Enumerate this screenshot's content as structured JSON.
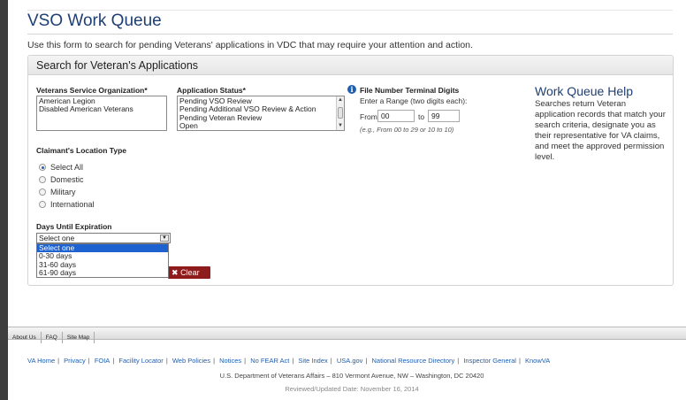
{
  "page": {
    "title": "VSO Work Queue",
    "intro": "Use this form to search for pending Veterans' applications in VDC that may require your attention and action."
  },
  "search_panel": {
    "heading": "Search for Veteran's Applications",
    "vso": {
      "label": "Veterans Service Organization*",
      "options": [
        "American Legion",
        "Disabled American Veterans"
      ]
    },
    "status": {
      "label": "Application Status*",
      "options": [
        "Pending VSO Review",
        "Pending Additional VSO Review & Action",
        "Pending Veteran Review",
        "Open"
      ]
    },
    "terminal_digits": {
      "label": "File Number Terminal Digits",
      "instruction": "Enter a Range (two digits each):",
      "from_label": "From",
      "from_value": "00",
      "to_label": "to",
      "to_value": "99",
      "hint": "(e.g., From 00 to 29 or 10 to 10)"
    },
    "location": {
      "label": "Claimant's Location Type",
      "options": [
        {
          "label": "Select All",
          "selected": true
        },
        {
          "label": "Domestic",
          "selected": false
        },
        {
          "label": "Military",
          "selected": false
        },
        {
          "label": "International",
          "selected": false
        }
      ]
    },
    "expiration": {
      "label": "Days Until Expiration",
      "selected": "Select one",
      "options": [
        "Select one",
        "0-30 days",
        "31-60 days",
        "61-90 days"
      ]
    },
    "clear_label": "Clear"
  },
  "help": {
    "title": "Work Queue Help",
    "text": "Searches return Veteran application records that match your search criteria, designate you as their representative for VA claims, and meet the approved permission level."
  },
  "footer": {
    "nav": [
      "About Us",
      "FAQ",
      "Site Map"
    ],
    "links": [
      "VA Home",
      "Privacy",
      "FOIA",
      "Facility Locator",
      "Web Policies",
      "Notices",
      "No FEAR Act",
      "Site Index",
      "USA.gov",
      "National Resource Directory",
      "Inspector General",
      "KnowVA"
    ],
    "address": "U.S. Department of Veterans Affairs – 810 Vermont Avenue, NW – Washington, DC 20420",
    "reviewed": "Reviewed/Updated Date: November 16, 2014"
  },
  "colors": {
    "heading_blue": "#1f3f73",
    "link_blue": "#1f5fb0",
    "clear_button": "#8f1c1c",
    "dropdown_highlight": "#1e62d0"
  }
}
